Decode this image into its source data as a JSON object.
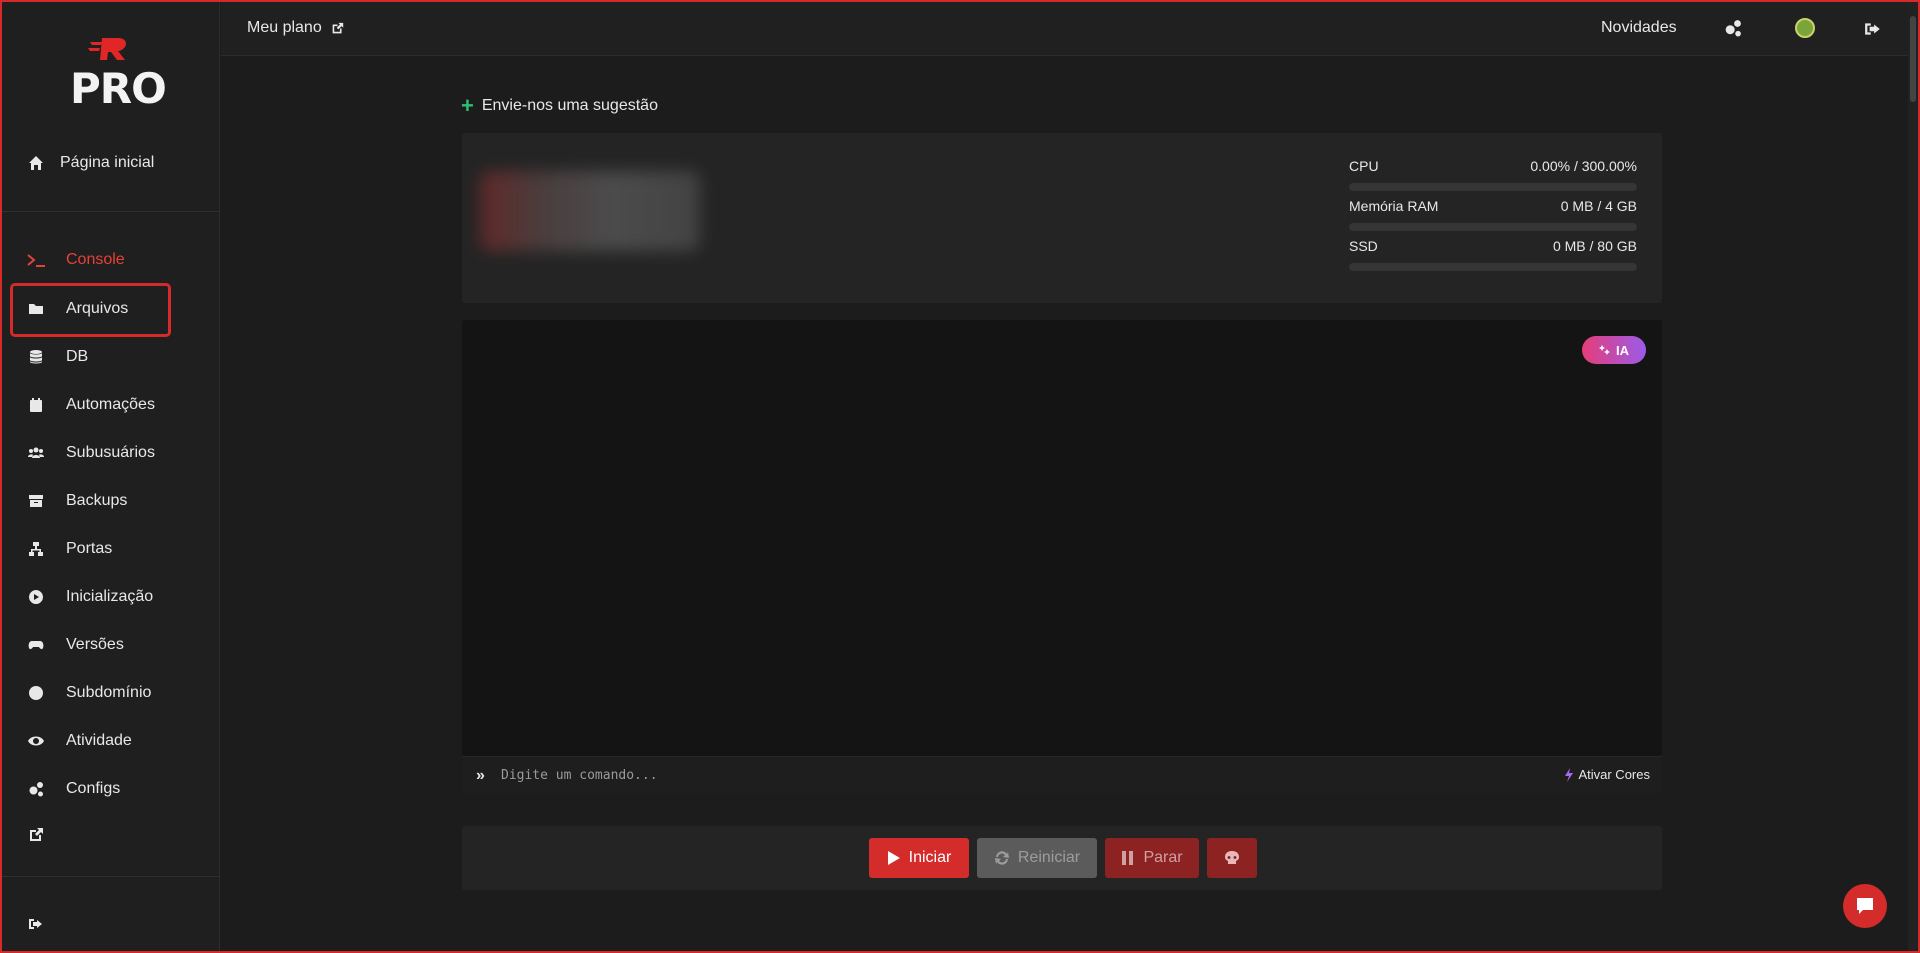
{
  "app": {
    "logo_text": "PRO"
  },
  "topbar": {
    "plan_label": "Meu plano",
    "news_label": "Novidades"
  },
  "sidebar": {
    "home_label": "Página inicial",
    "items": [
      {
        "label": "Console",
        "icon": "terminal-icon",
        "active": true
      },
      {
        "label": "Arquivos",
        "icon": "folder-icon"
      },
      {
        "label": "DB",
        "icon": "database-icon"
      },
      {
        "label": "Automações",
        "icon": "calendar-icon"
      },
      {
        "label": "Subusuários",
        "icon": "users-icon"
      },
      {
        "label": "Backups",
        "icon": "archive-icon"
      },
      {
        "label": "Portas",
        "icon": "network-icon"
      },
      {
        "label": "Inicialização",
        "icon": "play-circle-icon"
      },
      {
        "label": "Versões",
        "icon": "gamepad-icon"
      },
      {
        "label": "Subdomínio",
        "icon": "globe-icon"
      },
      {
        "label": "Atividade",
        "icon": "eye-icon"
      },
      {
        "label": "Configs",
        "icon": "gears-icon"
      }
    ]
  },
  "main": {
    "suggest_label": "Envie-nos uma sugestão",
    "stats": [
      {
        "label": "CPU",
        "value": "0.00% / 300.00%",
        "fill": 0
      },
      {
        "label": "Memória RAM",
        "value": "0 MB / 4 GB",
        "fill": 0
      },
      {
        "label": "SSD",
        "value": "0 MB / 80 GB",
        "fill": 0
      }
    ],
    "ia_badge": "IA",
    "command_placeholder": "Digite um comando...",
    "colors_label": "Ativar Cores",
    "buttons": {
      "start": "Iniciar",
      "restart": "Reiniciar",
      "stop": "Parar"
    }
  },
  "colors": {
    "accent": "#d42b2b",
    "active_nav": "#e5413a",
    "suggest_plus": "#2fbf71",
    "ia_gradient_start": "#e63d78",
    "ia_gradient_end": "#9b5bea"
  }
}
